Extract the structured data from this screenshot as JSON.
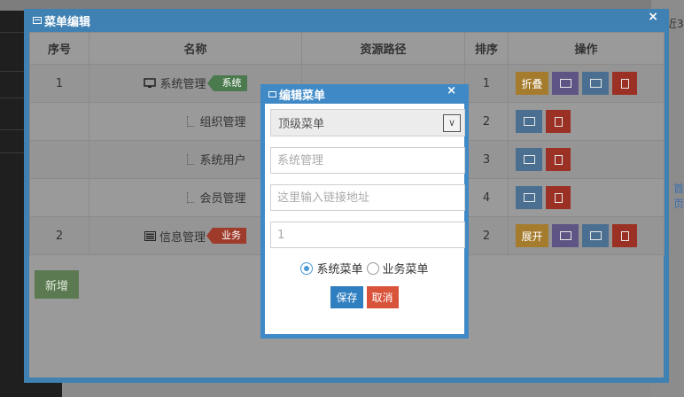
{
  "background": {
    "right_text_top": "近3",
    "right_text_mid": "首页"
  },
  "window": {
    "title": "菜单编辑",
    "close": "×",
    "headers": [
      "序号",
      "名称",
      "资源路径",
      "排序",
      "操作"
    ],
    "rows": [
      {
        "index": "1",
        "name": "系统管理",
        "icon": "monitor-icon",
        "tag": "系统",
        "tag_color": "#4a7a4e",
        "sort": "1",
        "first_btn": "折叠",
        "level": "top"
      },
      {
        "index": "",
        "name": "组织管理",
        "sort": "2",
        "level": "child"
      },
      {
        "index": "",
        "name": "系统用户",
        "sort": "3",
        "level": "child"
      },
      {
        "index": "",
        "name": "会员管理",
        "sort": "4",
        "level": "child"
      },
      {
        "index": "2",
        "name": "信息管理",
        "icon": "list-icon",
        "tag": "业务",
        "tag_color": "#9e3b2b",
        "sort": "2",
        "first_btn": "展开",
        "level": "top"
      }
    ],
    "add_button": "新增"
  },
  "dialog": {
    "title": "编辑菜单",
    "close": "×",
    "select_value": "顶级菜单",
    "name_placeholder": "系统管理",
    "url_placeholder": "这里输入链接地址",
    "sort_placeholder": "1",
    "radio_system": "系统菜单",
    "radio_business": "业务菜单",
    "radio_selected": "system",
    "save": "保存",
    "cancel": "取消"
  }
}
